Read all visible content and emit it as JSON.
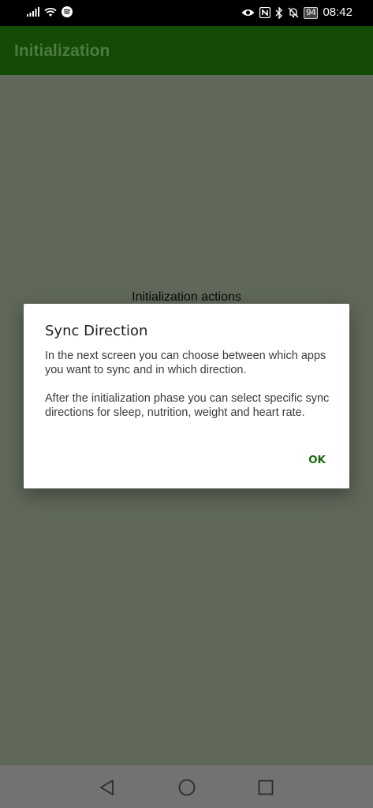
{
  "status_bar": {
    "time": "08:42",
    "battery": "94",
    "icons": [
      "signal-icon",
      "wifi-icon",
      "spotify-icon",
      "eye-icon",
      "nfc-icon",
      "bluetooth-icon",
      "mute-icon",
      "battery-icon"
    ]
  },
  "app_bar": {
    "title": "Initialization",
    "color": "#134b06"
  },
  "content": {
    "label": "Initialization actions"
  },
  "dialog": {
    "title": "Sync Direction",
    "paragraph1": "In the next screen you can choose between which apps you want to sync and in which direction.",
    "paragraph2": "After the initialization phase you can select specific sync directions for sleep, nutrition, weight and heart rate.",
    "ok_label": "OK",
    "accent": "#1c6a0e"
  },
  "nav_bar": {
    "icons": [
      "back-icon",
      "home-icon",
      "recents-icon"
    ]
  }
}
